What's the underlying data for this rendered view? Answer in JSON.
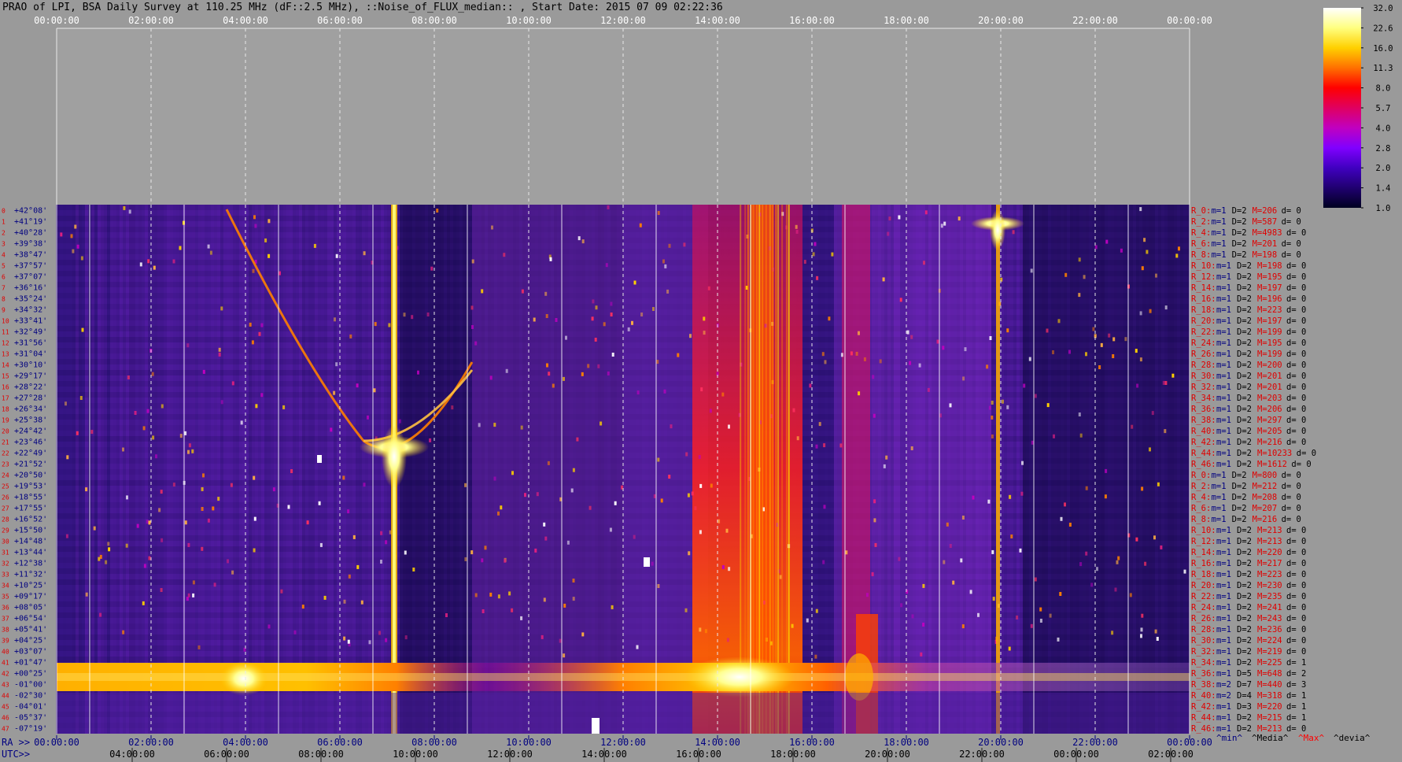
{
  "window": {
    "title": "PRAO of LPI, BSA Daily Survey at 110.25 MHz (dF::2.5 MHz), ::Noise_of_FLUX_median:: , Start Date: 2015 07 09 02:22:36"
  },
  "chart_data": {
    "type": "heatmap",
    "top_axis_ticks": [
      "00:00:00",
      "02:00:00",
      "04:00:00",
      "06:00:00",
      "08:00:00",
      "10:00:00",
      "12:00:00",
      "14:00:00",
      "16:00:00",
      "18:00:00",
      "20:00:00",
      "22:00:00",
      "00:00:00"
    ],
    "ra_axis_label": "RA >>",
    "ra_axis_ticks": [
      "00:00:00",
      "02:00:00",
      "04:00:00",
      "06:00:00",
      "08:00:00",
      "10:00:00",
      "12:00:00",
      "14:00:00",
      "16:00:00",
      "18:00:00",
      "20:00:00",
      "22:00:00",
      "00:00:00"
    ],
    "utc_axis_label": "UTC>>",
    "utc_axis_ticks": [
      "04:00:00",
      "06:00:00",
      "08:00:00",
      "10:00:00",
      "12:00:00",
      "14:00:00",
      "16:00:00",
      "18:00:00",
      "20:00:00",
      "22:00:00",
      "00:00:00",
      "02:00:00"
    ],
    "declinations": [
      "+42°08'",
      "+41°19'",
      "+40°28'",
      "+39°38'",
      "+38°47'",
      "+37°57'",
      "+37°07'",
      "+36°16'",
      "+35°24'",
      "+34°32'",
      "+33°41'",
      "+32°49'",
      "+31°56'",
      "+31°04'",
      "+30°10'",
      "+29°17'",
      "+28°22'",
      "+27°28'",
      "+26°34'",
      "+25°38'",
      "+24°42'",
      "+23°46'",
      "+22°49'",
      "+21°52'",
      "+20°50'",
      "+19°53'",
      "+18°55'",
      "+17°55'",
      "+16°52'",
      "+15°50'",
      "+14°48'",
      "+13°44'",
      "+12°38'",
      "+11°32'",
      "+10°25'",
      "+09°17'",
      "+08°05'",
      "+06°54'",
      "+05°41'",
      "+04°25'",
      "+03°07'",
      "+01°47'",
      "+00°25'",
      "-01°00'",
      "-02°30'",
      "-04°01'",
      "-05°37'",
      "-07°19'"
    ],
    "colorbar": {
      "ticks": [
        "32.0",
        "22.6",
        "16.0",
        "11.3",
        "8.0",
        "5.7",
        "4.0",
        "2.8",
        "2.0",
        "1.4",
        "1.0"
      ],
      "colors": [
        "#ffffff",
        "#ffff80",
        "#ffd000",
        "#ff7000",
        "#ff0000",
        "#e00060",
        "#c000c0",
        "#8000ff",
        "#4000c0",
        "#200070",
        "#000020"
      ]
    },
    "stats_rows": [
      {
        "label": "R_0:",
        "min": "m=1",
        "dev": "D=2",
        "max": "M=206",
        "d": "d= 0"
      },
      {
        "label": "R_2:",
        "min": "m=1",
        "dev": "D=2",
        "max": "M=587",
        "d": "d= 0"
      },
      {
        "label": "R_4:",
        "min": "m=1",
        "dev": "D=2",
        "max": "M=4983",
        "d": "d= 0"
      },
      {
        "label": "R_6:",
        "min": "m=1",
        "dev": "D=2",
        "max": "M=201",
        "d": "d= 0"
      },
      {
        "label": "R_8:",
        "min": "m=1",
        "dev": "D=2",
        "max": "M=198",
        "d": "d= 0"
      },
      {
        "label": "R_10:",
        "min": "m=1",
        "dev": "D=2",
        "max": "M=198",
        "d": "d= 0"
      },
      {
        "label": "R_12:",
        "min": "m=1",
        "dev": "D=2",
        "max": "M=195",
        "d": "d= 0"
      },
      {
        "label": "R_14:",
        "min": "m=1",
        "dev": "D=2",
        "max": "M=197",
        "d": "d= 0"
      },
      {
        "label": "R_16:",
        "min": "m=1",
        "dev": "D=2",
        "max": "M=196",
        "d": "d= 0"
      },
      {
        "label": "R_18:",
        "min": "m=1",
        "dev": "D=2",
        "max": "M=223",
        "d": "d= 0"
      },
      {
        "label": "R_20:",
        "min": "m=1",
        "dev": "D=2",
        "max": "M=197",
        "d": "d= 0"
      },
      {
        "label": "R_22:",
        "min": "m=1",
        "dev": "D=2",
        "max": "M=199",
        "d": "d= 0"
      },
      {
        "label": "R_24:",
        "min": "m=1",
        "dev": "D=2",
        "max": "M=195",
        "d": "d= 0"
      },
      {
        "label": "R_26:",
        "min": "m=1",
        "dev": "D=2",
        "max": "M=199",
        "d": "d= 0"
      },
      {
        "label": "R_28:",
        "min": "m=1",
        "dev": "D=2",
        "max": "M=200",
        "d": "d= 0"
      },
      {
        "label": "R_30:",
        "min": "m=1",
        "dev": "D=2",
        "max": "M=201",
        "d": "d= 0"
      },
      {
        "label": "R_32:",
        "min": "m=1",
        "dev": "D=2",
        "max": "M=201",
        "d": "d= 0"
      },
      {
        "label": "R_34:",
        "min": "m=1",
        "dev": "D=2",
        "max": "M=203",
        "d": "d= 0"
      },
      {
        "label": "R_36:",
        "min": "m=1",
        "dev": "D=2",
        "max": "M=206",
        "d": "d= 0"
      },
      {
        "label": "R_38:",
        "min": "m=1",
        "dev": "D=2",
        "max": "M=297",
        "d": "d= 0"
      },
      {
        "label": "R_40:",
        "min": "m=1",
        "dev": "D=2",
        "max": "M=205",
        "d": "d= 0"
      },
      {
        "label": "R_42:",
        "min": "m=1",
        "dev": "D=2",
        "max": "M=216",
        "d": "d= 0"
      },
      {
        "label": "R_44:",
        "min": "m=1",
        "dev": "D=2",
        "max": "M=10233",
        "d": "d= 0"
      },
      {
        "label": "R_46:",
        "min": "m=1",
        "dev": "D=2",
        "max": "M=1612",
        "d": "d= 0"
      },
      {
        "label": "R_0:",
        "min": "m=1",
        "dev": "D=2",
        "max": "M=800",
        "d": "d= 0"
      },
      {
        "label": "R_2:",
        "min": "m=1",
        "dev": "D=2",
        "max": "M=212",
        "d": "d= 0"
      },
      {
        "label": "R_4:",
        "min": "m=1",
        "dev": "D=2",
        "max": "M=208",
        "d": "d= 0"
      },
      {
        "label": "R_6:",
        "min": "m=1",
        "dev": "D=2",
        "max": "M=207",
        "d": "d= 0"
      },
      {
        "label": "R_8:",
        "min": "m=1",
        "dev": "D=2",
        "max": "M=216",
        "d": "d= 0"
      },
      {
        "label": "R_10:",
        "min": "m=1",
        "dev": "D=2",
        "max": "M=213",
        "d": "d= 0"
      },
      {
        "label": "R_12:",
        "min": "m=1",
        "dev": "D=2",
        "max": "M=213",
        "d": "d= 0"
      },
      {
        "label": "R_14:",
        "min": "m=1",
        "dev": "D=2",
        "max": "M=220",
        "d": "d= 0"
      },
      {
        "label": "R_16:",
        "min": "m=1",
        "dev": "D=2",
        "max": "M=217",
        "d": "d= 0"
      },
      {
        "label": "R_18:",
        "min": "m=1",
        "dev": "D=2",
        "max": "M=223",
        "d": "d= 0"
      },
      {
        "label": "R_20:",
        "min": "m=1",
        "dev": "D=2",
        "max": "M=230",
        "d": "d= 0"
      },
      {
        "label": "R_22:",
        "min": "m=1",
        "dev": "D=2",
        "max": "M=235",
        "d": "d= 0"
      },
      {
        "label": "R_24:",
        "min": "m=1",
        "dev": "D=2",
        "max": "M=241",
        "d": "d= 0"
      },
      {
        "label": "R_26:",
        "min": "m=1",
        "dev": "D=2",
        "max": "M=243",
        "d": "d= 0"
      },
      {
        "label": "R_28:",
        "min": "m=1",
        "dev": "D=2",
        "max": "M=236",
        "d": "d= 0"
      },
      {
        "label": "R_30:",
        "min": "m=1",
        "dev": "D=2",
        "max": "M=224",
        "d": "d= 0"
      },
      {
        "label": "R_32:",
        "min": "m=1",
        "dev": "D=2",
        "max": "M=219",
        "d": "d= 0"
      },
      {
        "label": "R_34:",
        "min": "m=1",
        "dev": "D=2",
        "max": "M=225",
        "d": "d= 1"
      },
      {
        "label": "R_36:",
        "min": "m=1",
        "dev": "D=5",
        "max": "M=648",
        "d": "d= 2"
      },
      {
        "label": "R_38:",
        "min": "m=2",
        "dev": "D=7",
        "max": "M=440",
        "d": "d= 3"
      },
      {
        "label": "R_40:",
        "min": "m=2",
        "dev": "D=4",
        "max": "M=318",
        "d": "d= 1"
      },
      {
        "label": "R_42:",
        "min": "m=1",
        "dev": "D=3",
        "max": "M=220",
        "d": "d= 1"
      },
      {
        "label": "R_44:",
        "min": "m=1",
        "dev": "D=2",
        "max": "M=215",
        "d": "d= 1"
      },
      {
        "label": "R_46:",
        "min": "m=1",
        "dev": "D=2",
        "max": "M=213",
        "d": "d= 0"
      }
    ],
    "stats_legend": [
      {
        "text": "^min^",
        "color": "#000080"
      },
      {
        "text": "^Media^",
        "color": "#000000"
      },
      {
        "text": "^Max^",
        "color": "#ff0000"
      },
      {
        "text": "^devia^",
        "color": "#000000"
      }
    ],
    "grid": true
  }
}
